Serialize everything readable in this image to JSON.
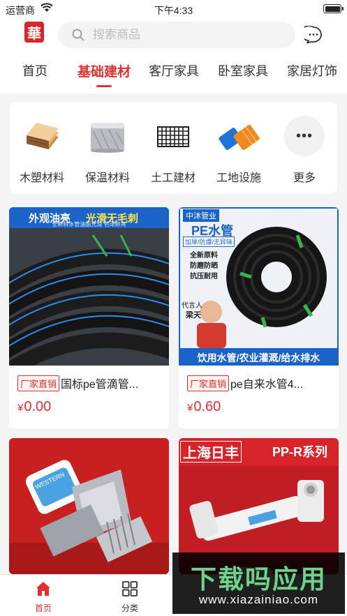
{
  "status_bar": {
    "carrier": "运营商",
    "time": "下午4:33"
  },
  "header": {
    "logo_char": "華",
    "search_placeholder": "搜索商品"
  },
  "tabs": [
    {
      "label": "首页",
      "active": false
    },
    {
      "label": "基础建材",
      "active": true
    },
    {
      "label": "客厅家具",
      "active": false
    },
    {
      "label": "卧室家具",
      "active": false
    },
    {
      "label": "家居灯饰",
      "active": false
    }
  ],
  "categories": [
    {
      "label": "木塑材料",
      "icon": "wood-plastic-board-icon"
    },
    {
      "label": "保温材料",
      "icon": "insulation-roll-icon"
    },
    {
      "label": "土工建材",
      "icon": "geogrid-mesh-icon"
    },
    {
      "label": "工地设施",
      "icon": "safety-net-roll-icon"
    },
    {
      "label": "更多",
      "icon": "more-icon"
    }
  ],
  "products": [
    {
      "badge": "厂家直销",
      "title": "国标pe管滴管...",
      "price": "0.00",
      "banner_left": "外观油亮",
      "banner_right": "光滑无毛刺",
      "banner_sub": "全新料水管油面光滑 色泽鲜亮"
    },
    {
      "badge": "厂家直销",
      "title": "pe自来水管4...",
      "price": "0.60",
      "brand": "中沐管业",
      "product_name": "PE水管",
      "tagline": "加厚/防爆/无异味",
      "features": [
        "全新原料",
        "防磨防晒",
        "抗压耐用"
      ],
      "endorser_label": "代言人",
      "endorser_name": "梁天",
      "bottom_banner": "饮用水管/农业灌溉/给水排水"
    },
    {
      "badge": "",
      "title": "",
      "price": "",
      "label_text": "WESTERN"
    },
    {
      "badge": "",
      "title": "",
      "price": "",
      "brand": "上海日丰",
      "series": "PP-R系列"
    }
  ],
  "currency": "¥",
  "bottom_nav": [
    {
      "label": "首页",
      "icon": "home-icon",
      "active": true
    },
    {
      "label": "分类",
      "icon": "grid-icon",
      "active": false
    }
  ],
  "watermark": {
    "main": "下载吗应用",
    "url": "www.xiazainiao.com"
  },
  "colors": {
    "accent": "#e1302d",
    "product_banner_blue": "#1a63c9"
  }
}
